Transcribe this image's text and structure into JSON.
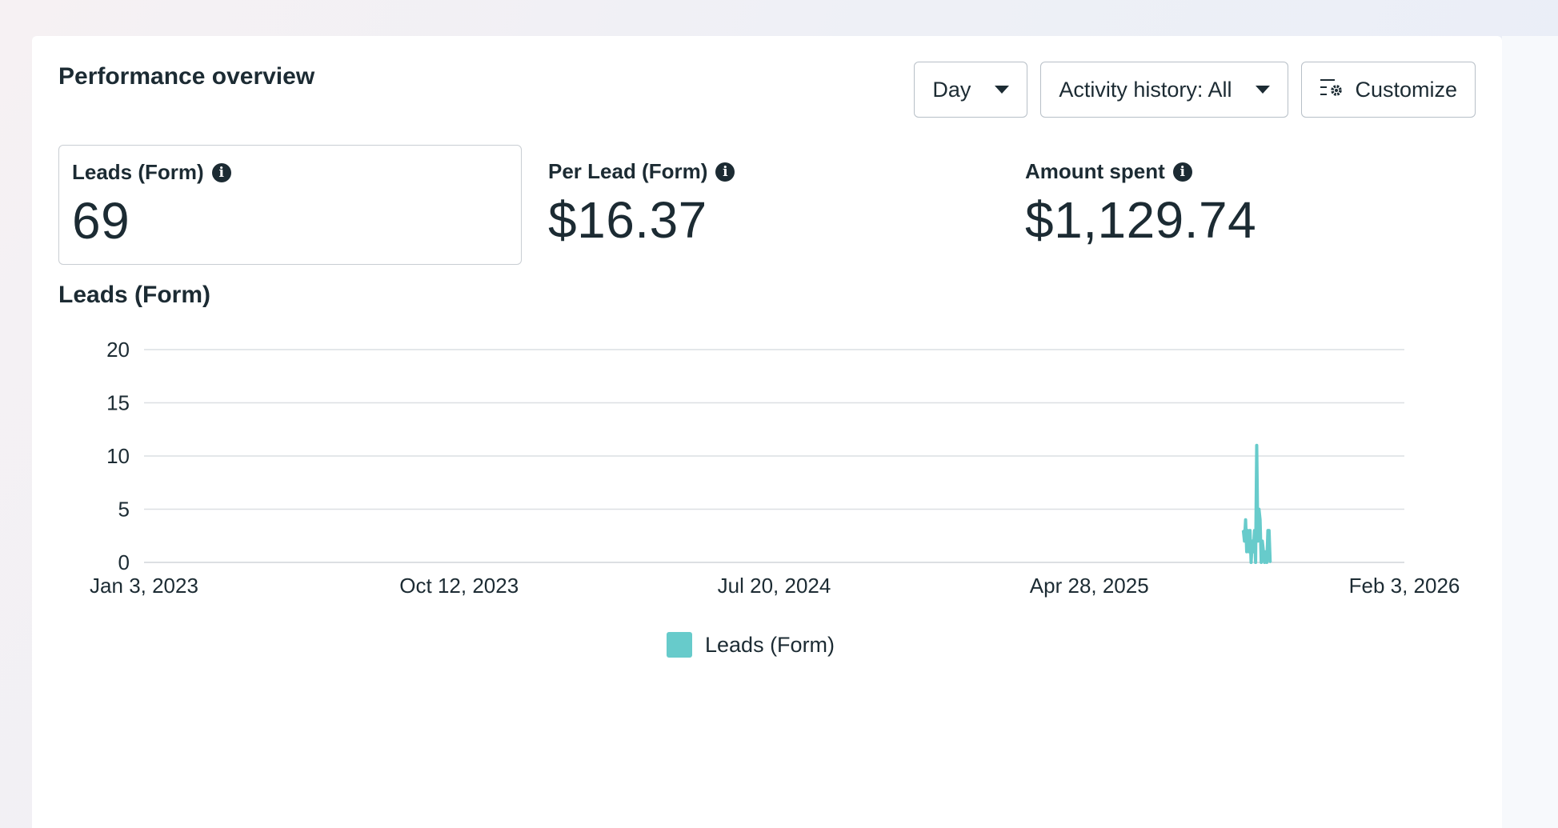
{
  "header": {
    "title": "Performance overview",
    "day_label": "Day",
    "activity_label": "Activity history: All",
    "customize_label": "Customize"
  },
  "metrics": [
    {
      "label": "Leads (Form)",
      "value": "69",
      "selected": true
    },
    {
      "label": "Per Lead (Form)",
      "value": "$16.37",
      "selected": false
    },
    {
      "label": "Amount spent",
      "value": "$1,129.74",
      "selected": false
    }
  ],
  "colors": {
    "series": "#67cbcb",
    "gridline": "#dcdfe3",
    "text": "#1c2b33"
  },
  "icons": {
    "info": "info-icon",
    "caret": "caret-down-icon",
    "customize": "customize-columns-icon"
  },
  "chart_data": {
    "type": "line",
    "title": "Leads (Form)",
    "x_ticks": [
      "Jan 3, 2023",
      "Oct 12, 2023",
      "Jul 20, 2024",
      "Apr 28, 2025",
      "Feb 3, 2026"
    ],
    "y_ticks": [
      0,
      5,
      10,
      15,
      20
    ],
    "ylim": [
      0,
      20
    ],
    "xlim": [
      "2023-01-03",
      "2026-02-03"
    ],
    "grid": true,
    "legend_position": "bottom-center",
    "series": [
      {
        "name": "Leads (Form)",
        "points": [
          [
            "2025-09-12",
            3
          ],
          [
            "2025-09-13",
            2
          ],
          [
            "2025-09-14",
            4
          ],
          [
            "2025-09-15",
            1
          ],
          [
            "2025-09-16",
            3
          ],
          [
            "2025-09-17",
            1
          ],
          [
            "2025-09-18",
            3
          ],
          [
            "2025-09-19",
            0
          ],
          [
            "2025-09-20",
            2
          ],
          [
            "2025-09-21",
            1
          ],
          [
            "2025-09-22",
            3
          ],
          [
            "2025-09-23",
            0
          ],
          [
            "2025-09-24",
            11
          ],
          [
            "2025-09-25",
            2
          ],
          [
            "2025-09-26",
            5
          ],
          [
            "2025-09-27",
            4
          ],
          [
            "2025-09-28",
            0
          ],
          [
            "2025-09-29",
            2
          ],
          [
            "2025-09-30",
            1
          ],
          [
            "2025-10-01",
            0
          ],
          [
            "2025-10-02",
            1
          ],
          [
            "2025-10-03",
            0
          ],
          [
            "2025-10-04",
            3
          ],
          [
            "2025-10-05",
            3
          ],
          [
            "2025-10-06",
            0
          ]
        ]
      }
    ],
    "legend": [
      "Leads (Form)"
    ]
  }
}
